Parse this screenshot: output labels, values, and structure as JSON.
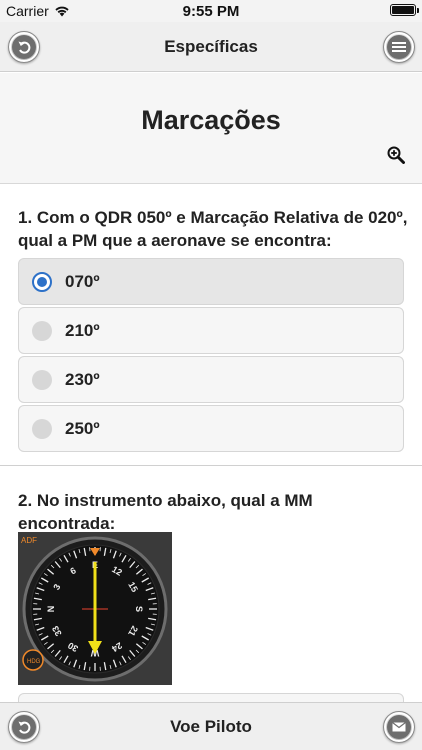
{
  "status_bar": {
    "carrier": "Carrier",
    "time": "9:55 PM"
  },
  "nav": {
    "title": "Específicas"
  },
  "page": {
    "title": "Marcações"
  },
  "questions": [
    {
      "text": "1. Com o QDR 050º e Marcação Relativa de 020º, qual a PM que a aeronave se encontra:",
      "options": [
        {
          "label": "070º",
          "selected": true
        },
        {
          "label": "210º",
          "selected": false
        },
        {
          "label": "230º",
          "selected": false
        },
        {
          "label": "250º",
          "selected": false
        }
      ]
    },
    {
      "text": "2. No instrumento abaixo, qual a MM encontrada:",
      "image": {
        "adf_label": "ADF",
        "hdg_label": "HDG",
        "dial_numbers": [
          "N",
          "3",
          "6",
          "E",
          "12",
          "15",
          "S",
          "21",
          "24",
          "W",
          "30",
          "33"
        ]
      }
    }
  ],
  "bottom_bar": {
    "title": "Voe Piloto"
  },
  "colors": {
    "accent": "#2d71c8",
    "needle": "#f0e019",
    "marker": "#f0892a"
  }
}
